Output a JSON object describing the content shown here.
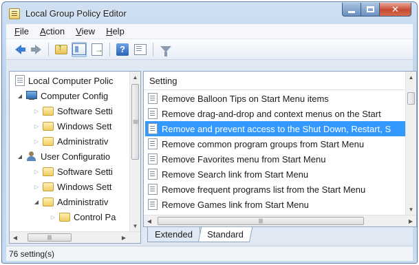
{
  "window": {
    "title": "Local Group Policy Editor"
  },
  "menu": [
    {
      "label": "File",
      "key": "F",
      "rest": "ile"
    },
    {
      "label": "Action",
      "key": "A",
      "rest": "ction"
    },
    {
      "label": "View",
      "key": "V",
      "rest": "iew"
    },
    {
      "label": "Help",
      "key": "H",
      "rest": "elp"
    }
  ],
  "toolbar": [
    "back-icon",
    "forward-icon",
    "up-folder-icon",
    "show-hide-tree-icon",
    "export-list-icon",
    "help-icon",
    "properties-icon",
    "filter-icon"
  ],
  "tree": [
    {
      "label": "Local Computer Polic",
      "icon": "policy-icon",
      "level": 0,
      "expander": ""
    },
    {
      "label": "Computer Config",
      "icon": "computer-icon",
      "level": 1,
      "expander": "expanded"
    },
    {
      "label": "Software Setti",
      "icon": "folder-icon",
      "level": 2,
      "expander": "collapsed"
    },
    {
      "label": "Windows Sett",
      "icon": "folder-icon",
      "level": 2,
      "expander": "collapsed"
    },
    {
      "label": "Administrativ",
      "icon": "folder-icon",
      "level": 2,
      "expander": "collapsed"
    },
    {
      "label": "User Configuratio",
      "icon": "user-icon",
      "level": 1,
      "expander": "expanded"
    },
    {
      "label": "Software Setti",
      "icon": "folder-icon",
      "level": 2,
      "expander": "collapsed"
    },
    {
      "label": "Windows Sett",
      "icon": "folder-icon",
      "level": 2,
      "expander": "collapsed"
    },
    {
      "label": "Administrativ",
      "icon": "folder-icon",
      "level": 2,
      "expander": "expanded"
    },
    {
      "label": "Control Pa",
      "icon": "folder-icon",
      "level": 3,
      "expander": "collapsed"
    }
  ],
  "list": {
    "header": "Setting",
    "rows": [
      "Remove Balloon Tips on Start Menu items",
      "Remove drag-and-drop and context menus on the Start",
      "Remove and prevent access to the Shut Down, Restart, S",
      "Remove common program groups from Start Menu",
      "Remove Favorites menu from Start Menu",
      "Remove Search link from Start Menu",
      "Remove frequent programs list from the Start Menu",
      "Remove Games link from Start Menu"
    ],
    "selected_index": 2
  },
  "tabs": {
    "extended": "Extended",
    "standard": "Standard",
    "active": "Standard"
  },
  "status": {
    "text": "76 setting(s)"
  },
  "colors": {
    "selection": "#3399ff",
    "frame": "#b9d1ea",
    "close": "#c74a32"
  }
}
